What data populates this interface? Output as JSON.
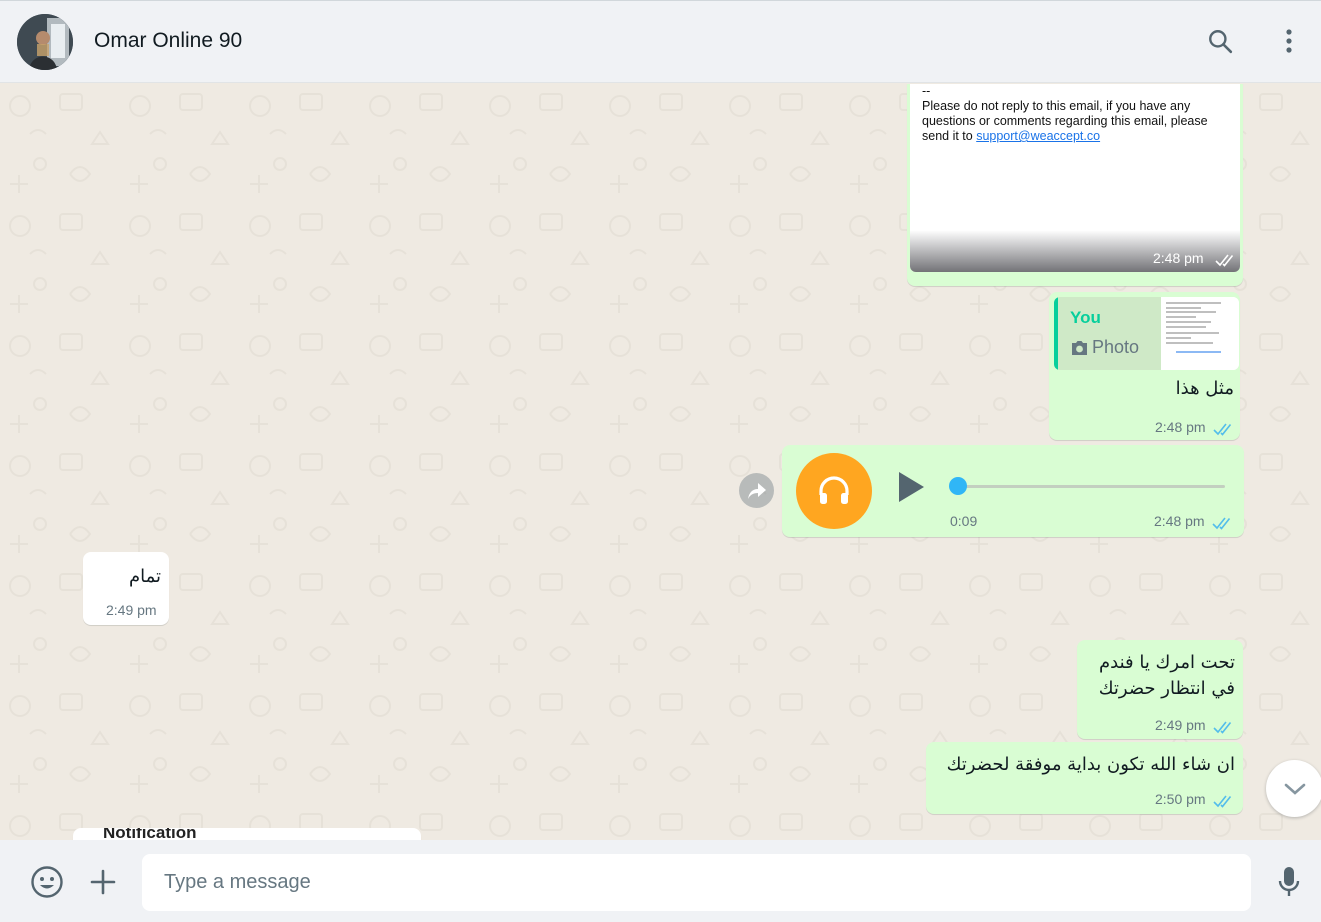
{
  "header": {
    "contact_name": "Omar Online 90"
  },
  "messages": {
    "email_image": {
      "lines": [
        "--",
        "Please do not reply to this email, if you have any",
        "questions or comments regarding this email, please",
        "send it to "
      ],
      "link": "support@weaccept.co",
      "time": "2:48 pm"
    },
    "reply": {
      "quote_author": "You",
      "quote_type": "Photo",
      "text": "مثل هذا",
      "time": "2:48 pm"
    },
    "voice": {
      "duration": "0:09",
      "time": "2:48 pm"
    },
    "incoming": {
      "text": "تمام",
      "time": "2:49 pm"
    },
    "out_two_line": {
      "line1": "تحت امرك يا فندم",
      "line2": "في انتظار حضرتك",
      "time": "2:49 pm"
    },
    "out_last": {
      "text": "ان شاء الله تكون بداية موفقة لحضرتك",
      "time": "2:50 pm"
    },
    "partial_incoming": {
      "text": "Notification"
    }
  },
  "footer": {
    "placeholder": "Type a message"
  },
  "colors": {
    "outgoing_bubble": "#d9fdd3",
    "incoming_bubble": "#ffffff",
    "read_ticks": "#53bdeb",
    "accent": "#06cf9c",
    "voice_avatar": "#ffa620"
  }
}
